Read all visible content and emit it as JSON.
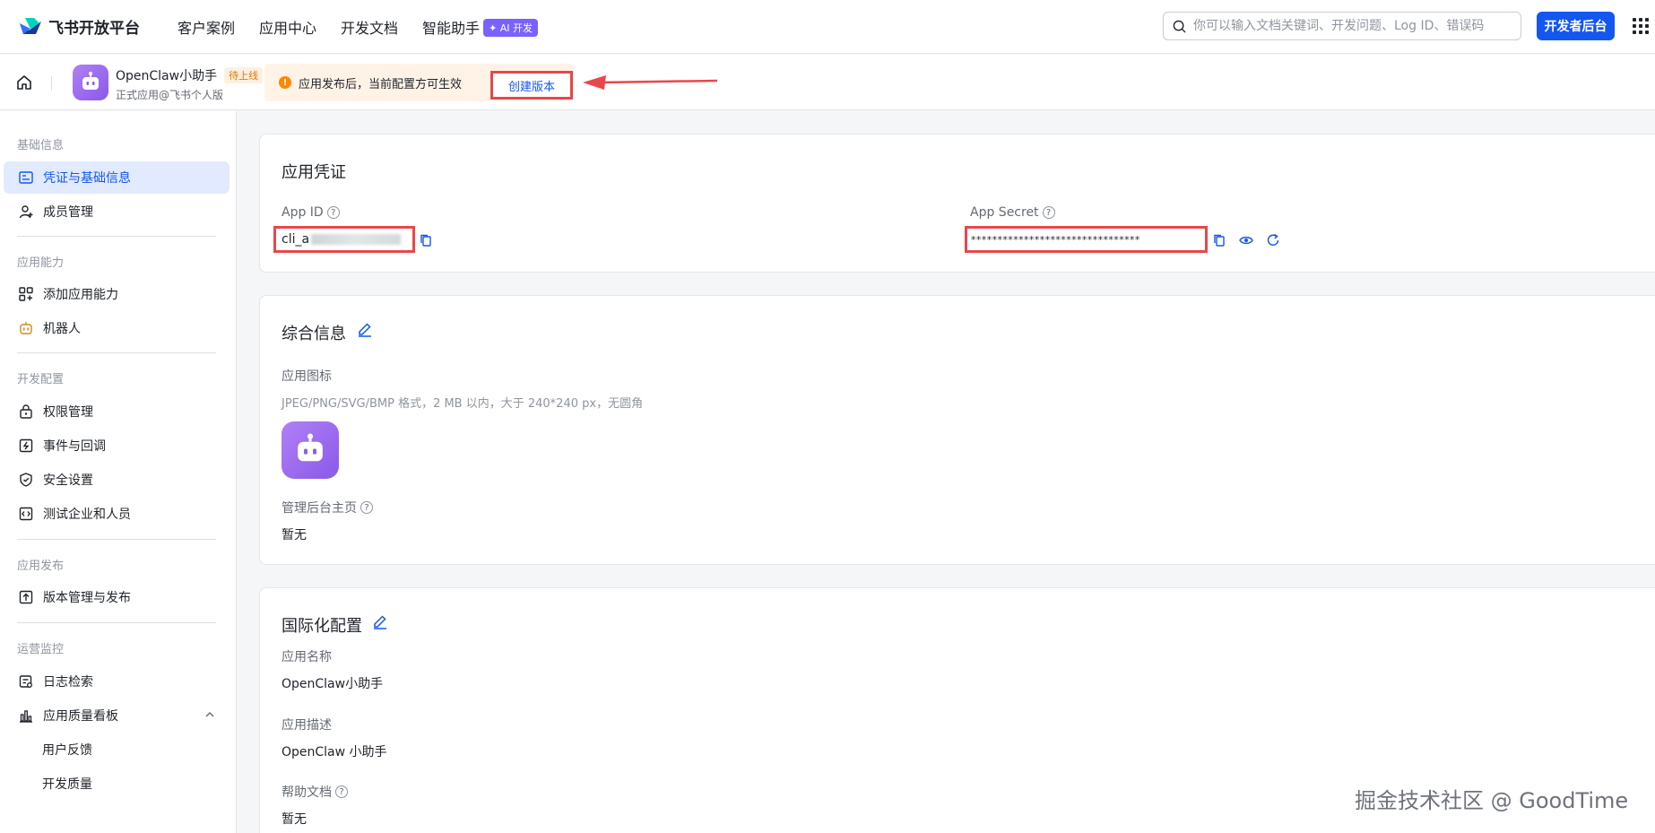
{
  "topnav": {
    "brand": "飞书开放平台",
    "links": [
      "客户案例",
      "应用中心",
      "开发文档",
      "智能助手"
    ],
    "ai_badge": "✦ AI 开发",
    "search_placeholder": "你可以输入文档关键词、开发问题、Log ID、错误码",
    "dev_console": "开发者后台"
  },
  "appbar": {
    "app_name": "OpenClaw小助手",
    "status": "待上线",
    "app_sub": "正式应用@飞书个人版",
    "notice": "应用发布后，当前配置方可生效",
    "create_version": "创建版本"
  },
  "sidebar": {
    "sections": [
      "基础信息",
      "应用能力",
      "开发配置",
      "应用发布",
      "运营监控"
    ],
    "items": [
      {
        "label": "凭证与基础信息",
        "icon": "credential-icon",
        "active": true
      },
      {
        "label": "成员管理",
        "icon": "user-add-icon"
      },
      {
        "label": "添加应用能力",
        "icon": "apps-add-icon"
      },
      {
        "label": "机器人",
        "icon": "robot-icon"
      },
      {
        "label": "权限管理",
        "icon": "lock-icon"
      },
      {
        "label": "事件与回调",
        "icon": "event-icon"
      },
      {
        "label": "安全设置",
        "icon": "shield-icon"
      },
      {
        "label": "测试企业和人员",
        "icon": "test-icon"
      },
      {
        "label": "版本管理与发布",
        "icon": "upload-icon"
      },
      {
        "label": "日志检索",
        "icon": "log-icon"
      },
      {
        "label": "应用质量看板",
        "icon": "chart-icon"
      },
      {
        "label": "用户反馈"
      },
      {
        "label": "开发质量"
      }
    ]
  },
  "credentials": {
    "title": "应用凭证",
    "app_id_label": "App ID",
    "app_id_value": "cli_a",
    "app_secret_label": "App Secret",
    "app_secret_value": "********************************"
  },
  "general": {
    "title": "综合信息",
    "icon_label": "应用图标",
    "icon_hint": "JPEG/PNG/SVG/BMP 格式，2 MB 以内，大于 240*240 px，无圆角",
    "admin_label": "管理后台主页",
    "admin_value": "暂无"
  },
  "i18n": {
    "title": "国际化配置",
    "name_label": "应用名称",
    "name_value": "OpenClaw小助手",
    "desc_label": "应用描述",
    "desc_value": "OpenClaw 小助手",
    "help_label": "帮助文档",
    "help_value": "暂无"
  },
  "watermark": "掘金技术社区 @ GoodTime",
  "colors": {
    "primary": "#1456f0",
    "highlight": "#e8474b",
    "warning": "#ff8800",
    "purple": "#8a59e8"
  }
}
